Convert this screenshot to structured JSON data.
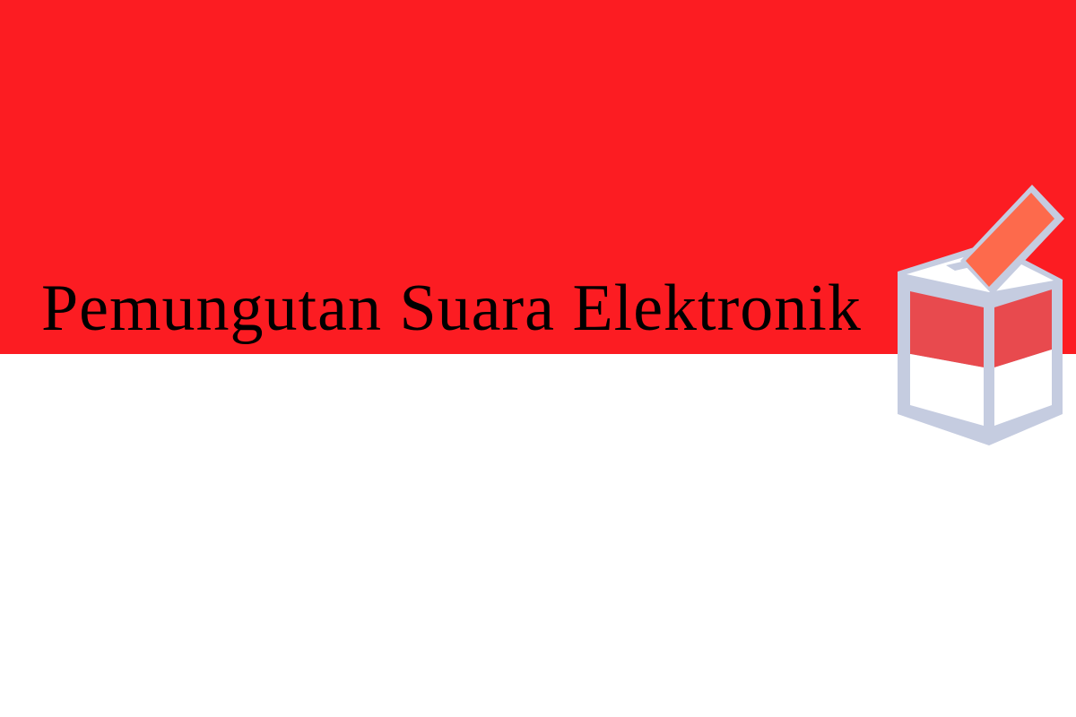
{
  "banner": {
    "title": "Pemungutan Suara Elektronik"
  },
  "colors": {
    "flag_red": "#fc1c22",
    "flag_white": "#ffffff",
    "title_text": "#000000",
    "box_frame": "#c5cce0",
    "box_red": "#e84a4e",
    "box_white": "#ffffff",
    "ballot_paper": "#fd6a4c"
  },
  "icons": {
    "emblem": "ballot-box-icon"
  }
}
